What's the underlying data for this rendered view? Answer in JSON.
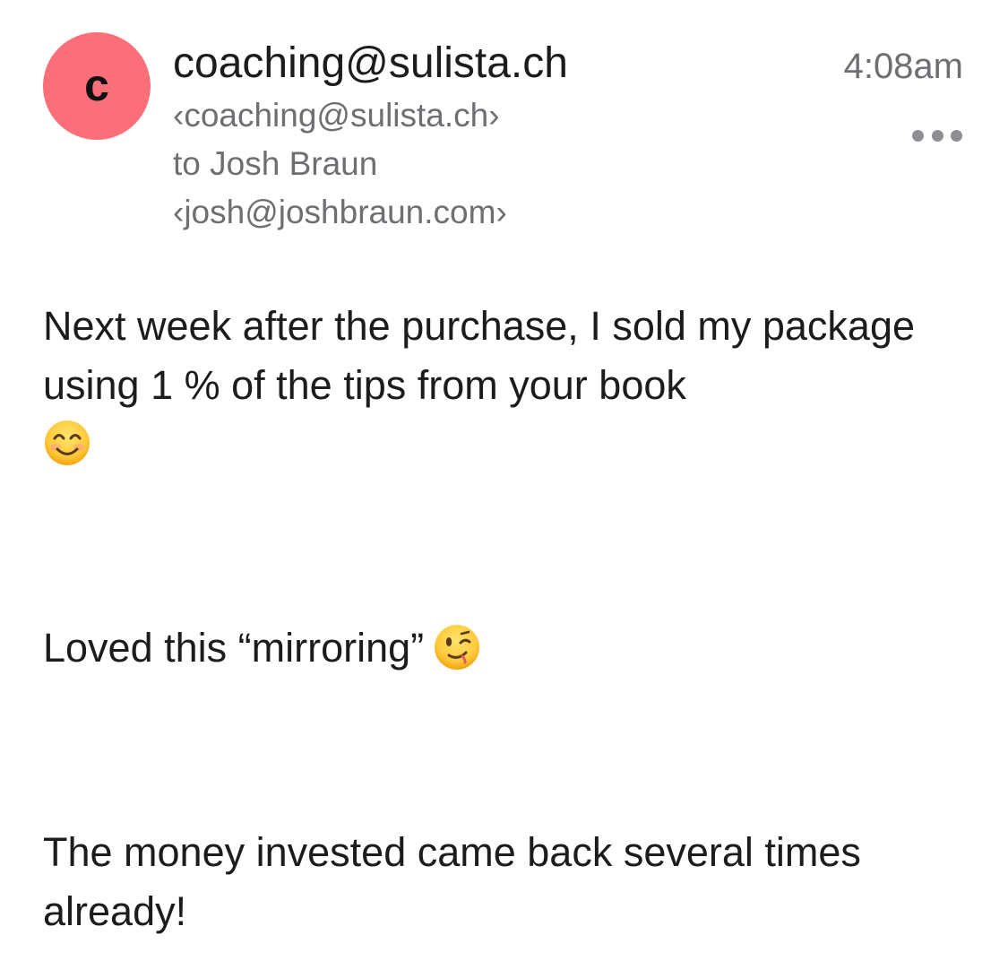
{
  "sender": {
    "avatar_letter": "c",
    "avatar_color": "#fb6f7a",
    "name": "coaching@sulista.ch",
    "email": "‹coaching@sulista.ch›"
  },
  "recipient": {
    "line": "to Josh Braun",
    "email": "‹josh@joshbraun.com›"
  },
  "timestamp": "4:08am",
  "more_icon": "ellipsis-icon",
  "body": {
    "paragraph_1": "Next week after the purchase, I sold my package using 1 % of the tips from your book",
    "paragraph_1_emoji": "smiling-face-with-smiling-eyes-icon",
    "paragraph_2": "Loved this “mirroring”",
    "paragraph_2_emoji": "winking-face-icon",
    "paragraph_3": "The money invested came back several times already!"
  }
}
